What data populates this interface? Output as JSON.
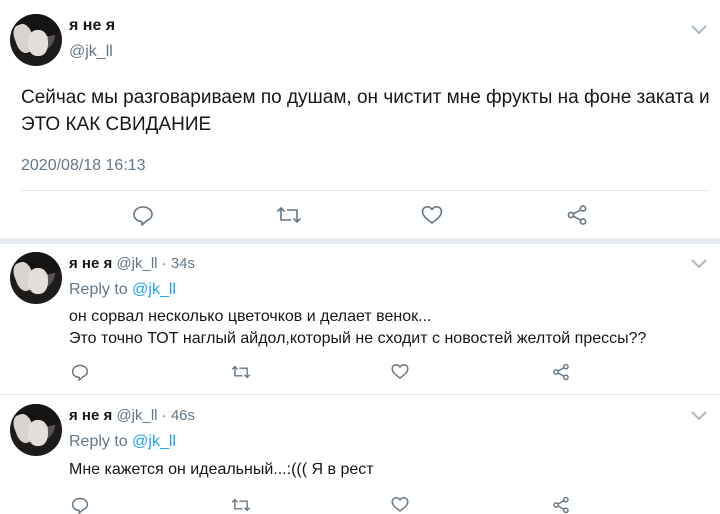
{
  "main_tweet": {
    "name": "я не я",
    "handle": "@jk_ll",
    "text": "Сейчас мы разговариваем по душам, он чистит мне фрукты на фоне заката и ЭТО КАК СВИДАНИЕ",
    "timestamp": "2020/08/18 16:13"
  },
  "replies": [
    {
      "name": "я не я",
      "handle": "@jk_ll",
      "age": "· 34s",
      "reply_to_label": "Reply to",
      "reply_to_handle": "@jk_ll",
      "text": "он сорвал несколько цветочков и делает венок...\nЭто точно ТОТ наглый айдол,который не сходит с новостей желтой прессы??"
    },
    {
      "name": "я не я",
      "handle": "@jk_ll",
      "age": "· 46s",
      "reply_to_label": "Reply to",
      "reply_to_handle": "@jk_ll",
      "text": "Мне кажется он идеальный...:((( Я в рест"
    }
  ],
  "colors": {
    "text": "#14171a",
    "secondary": "#657786",
    "accent": "#1da1f2",
    "divider": "#e1e8ed"
  },
  "icons": [
    "reply-icon",
    "retweet-icon",
    "like-icon",
    "share-icon",
    "chevron-down-icon"
  ]
}
